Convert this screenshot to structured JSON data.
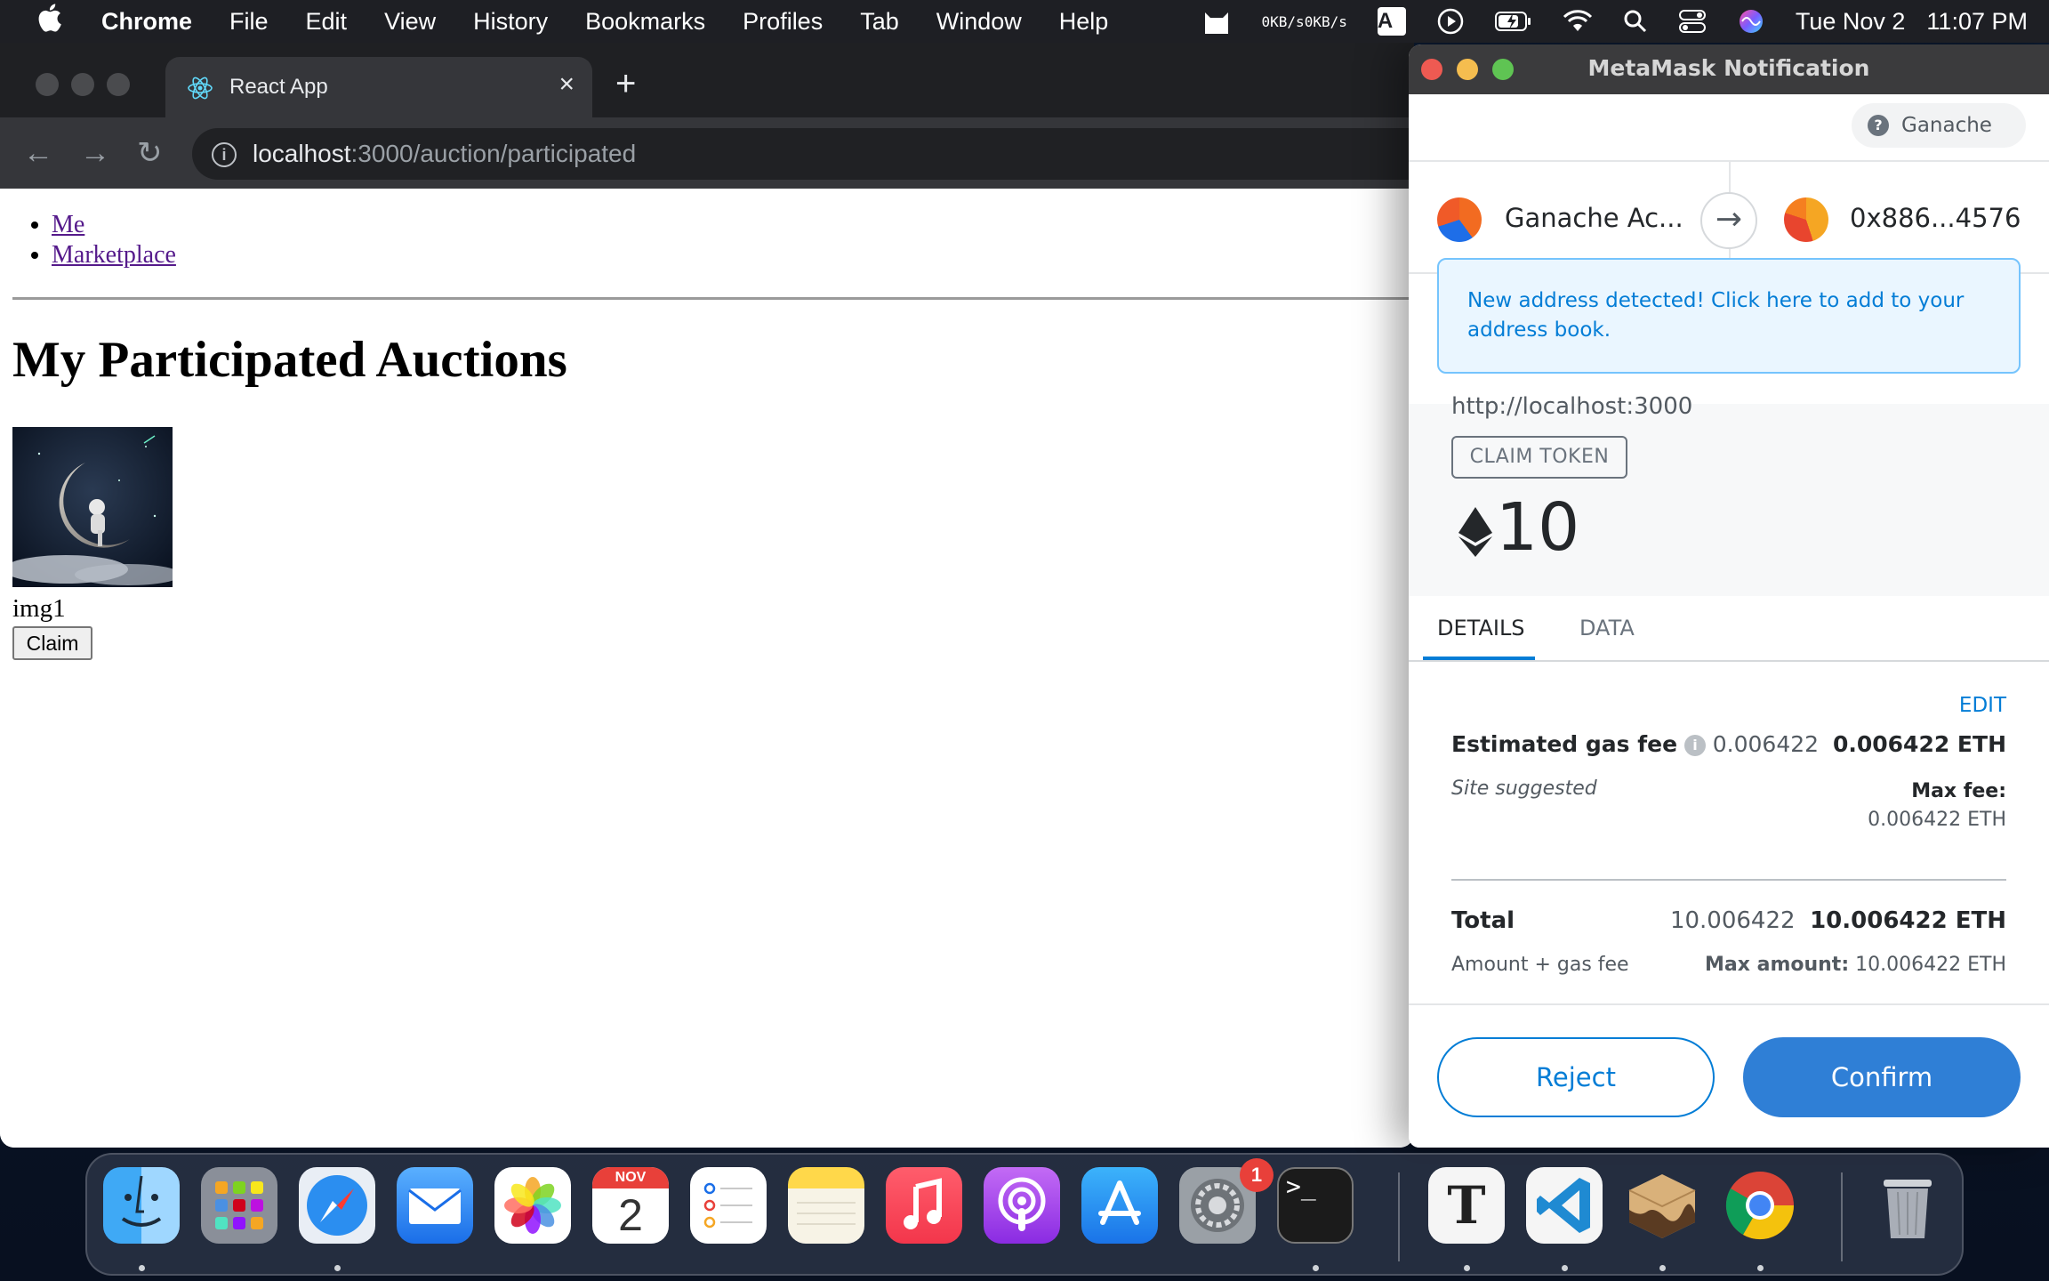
{
  "menubar": {
    "app": "Chrome",
    "items": [
      "File",
      "Edit",
      "View",
      "History",
      "Bookmarks",
      "Profiles",
      "Tab",
      "Window",
      "Help"
    ],
    "net_up": "0KB/s",
    "net_down": "0KB/s",
    "input_source": "A",
    "date": "Tue Nov 2",
    "time": "11:07 PM"
  },
  "browser": {
    "tab_title": "React App",
    "url_host": "localhost",
    "url_path": ":3000/auction/participated"
  },
  "page": {
    "nav": [
      "Me",
      "Marketplace"
    ],
    "title": "My Participated Auctions",
    "item_label": "img1",
    "claim_button": "Claim"
  },
  "metamask": {
    "window_title": "MetaMask Notification",
    "network": "Ganache",
    "from_account": "Ganache Ac...",
    "to_address": "0x886...4576",
    "banner": "New address detected! Click here to add to your address book.",
    "origin": "http://localhost:3000",
    "method": "CLAIM TOKEN",
    "amount": "10",
    "tabs": [
      "DETAILS",
      "DATA"
    ],
    "edit": "EDIT",
    "gas_label": "Estimated gas fee",
    "gas_value": "0.006422",
    "gas_value_eth": "0.006422 ETH",
    "site_suggested": "Site suggested",
    "max_fee_label": "Max fee:",
    "max_fee_value": "0.006422 ETH",
    "total_label": "Total",
    "total_value": "10.006422",
    "total_value_eth": "10.006422 ETH",
    "amount_gas_label": "Amount + gas fee",
    "max_amount_label": "Max amount:",
    "max_amount_value": "10.006422 ETH",
    "reject": "Reject",
    "confirm": "Confirm",
    "colors": {
      "accent": "#037dd6",
      "confirm_bg": "#2f7fd6"
    }
  },
  "dock": {
    "calendar_month": "NOV",
    "calendar_day": "2",
    "settings_badge": "1",
    "terminal_prompt": ">_",
    "typora_letter": "T"
  }
}
